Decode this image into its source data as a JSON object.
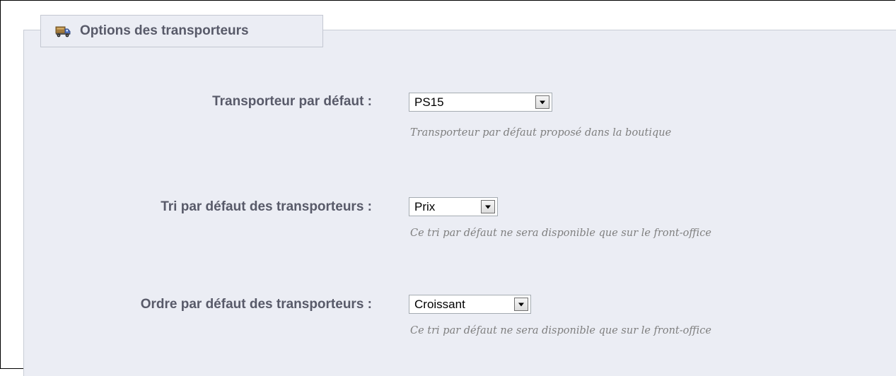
{
  "section": {
    "title": "Options des transporteurs",
    "icon": "truck-icon"
  },
  "fields": [
    {
      "label": "Transporteur par défaut :",
      "value": "PS15",
      "hint": "Transporteur par défaut proposé dans la boutique"
    },
    {
      "label": "Tri par défaut des transporteurs :",
      "value": "Prix",
      "hint": "Ce tri par défaut ne sera disponible que sur le front-office"
    },
    {
      "label": "Ordre par défaut des transporteurs :",
      "value": "Croissant",
      "hint": "Ce tri par défaut ne sera disponible que sur le front-office"
    }
  ],
  "colors": {
    "panel_background": "#ebedf4",
    "label_text": "#585a69",
    "hint_text": "#7f7f7f"
  }
}
